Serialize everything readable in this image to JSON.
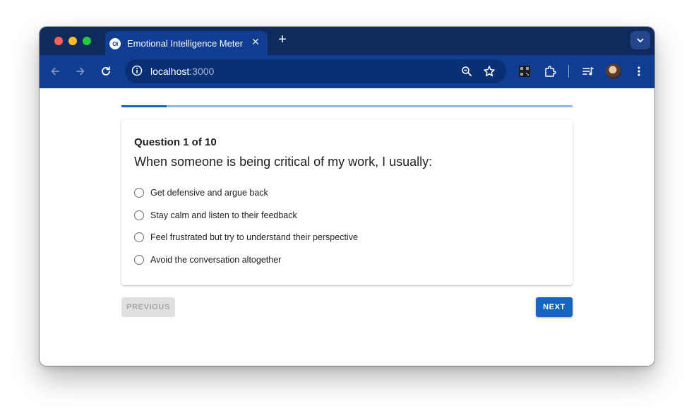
{
  "browser": {
    "tab_title": "Emotional Intelligence Meter",
    "favicon_text": "OI",
    "url_host": "localhost",
    "url_port": ":3000"
  },
  "quiz": {
    "progress_fraction": 0.1,
    "question_counter": "Question 1 of 10",
    "question_text": "When someone is being critical of my work, I usually:",
    "options": [
      "Get defensive and argue back",
      "Stay calm and listen to their feedback",
      "Feel frustrated but try to understand their perspective",
      "Avoid the conversation altogether"
    ],
    "previous_label": "PREVIOUS",
    "next_label": "NEXT"
  },
  "colors": {
    "tab_strip": "#0f2a5c",
    "toolbar": "#0e3d91",
    "primary": "#1565c0",
    "progress_track": "#92b8e5",
    "disabled_button": "#e0e0e0"
  },
  "icons": {
    "toolbar": [
      "back-arrow-icon",
      "forward-arrow-icon",
      "reload-icon",
      "info-icon",
      "zoom-out-icon",
      "bookmark-star-icon",
      "qr-code-icon",
      "extensions-puzzle-icon",
      "reading-list-icon",
      "profile-avatar",
      "kebab-menu-icon"
    ]
  }
}
